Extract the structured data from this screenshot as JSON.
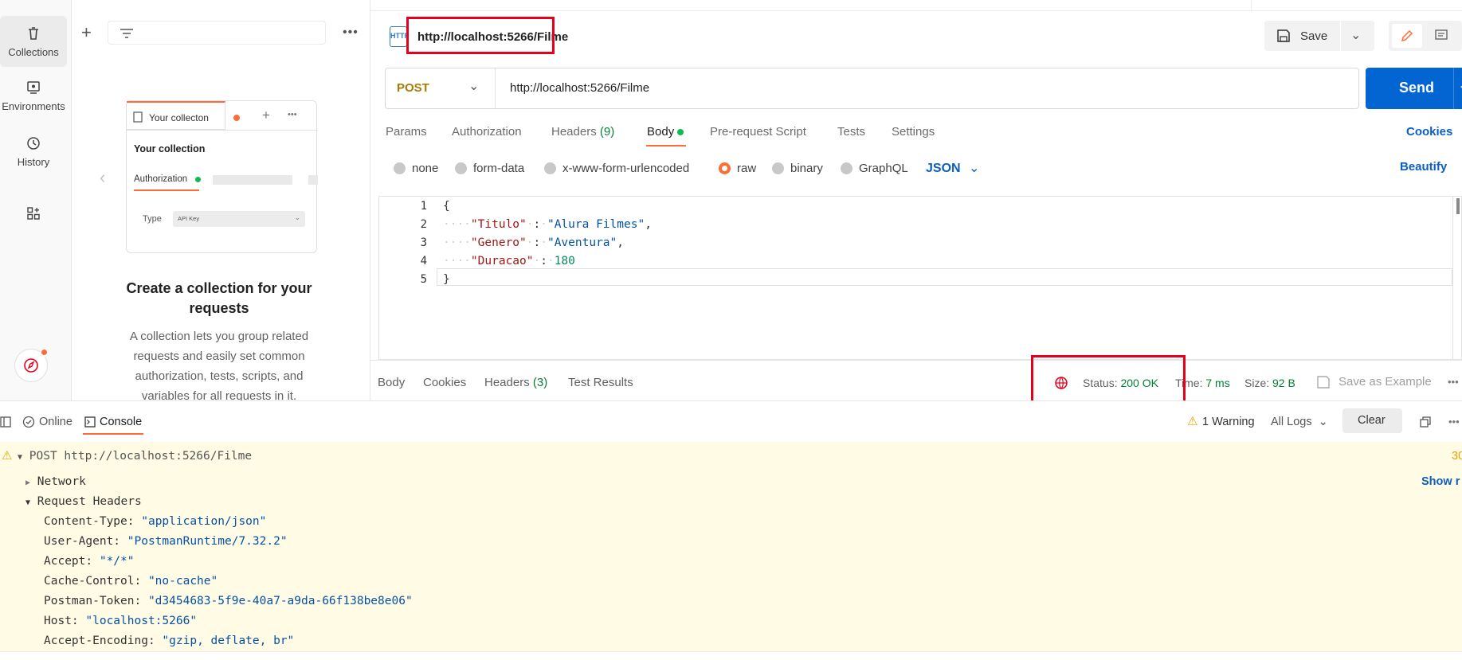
{
  "rail": {
    "collections": "Collections",
    "environments": "Environments",
    "history": "History"
  },
  "sidebar": {
    "preview_tab": "Your collecton",
    "preview_title": "Your collection",
    "preview_auth": "Authorization",
    "preview_type": "Type",
    "preview_type_value": "API Key",
    "empty_title": "Create a collection for your requests",
    "empty_desc": "A collection lets you group related requests and easily set common authorization, tests, scripts, and variables for all requests in it."
  },
  "request": {
    "badge": "HTTP",
    "name": "http://localhost:5266/Filme",
    "save": "Save",
    "method": "POST",
    "url": "http://localhost:5266/Filme",
    "send": "Send"
  },
  "tabs": {
    "params": "Params",
    "authorization": "Authorization",
    "headers": "Headers",
    "headers_count": "(9)",
    "body": "Body",
    "prerequest": "Pre-request Script",
    "tests": "Tests",
    "settings": "Settings",
    "cookies": "Cookies"
  },
  "body_types": {
    "none": "none",
    "form_data": "form-data",
    "urlencoded": "x-www-form-urlencoded",
    "raw": "raw",
    "binary": "binary",
    "graphql": "GraphQL",
    "format": "JSON",
    "beautify": "Beautify"
  },
  "code": {
    "line_numbers": [
      "1",
      "2",
      "3",
      "4",
      "5"
    ],
    "open": "{",
    "close": "}",
    "k1": "\"Titulo\"",
    "v1": "\"Alura Filmes\"",
    "k2": "\"Genero\"",
    "v2": "\"Aventura\"",
    "k3": "\"Duracao\"",
    "v3": "180"
  },
  "response": {
    "body": "Body",
    "cookies": "Cookies",
    "headers": "Headers",
    "headers_count": "(3)",
    "test_results": "Test Results",
    "status_label": "Status:",
    "status_value": "200 OK",
    "time_label": "Time:",
    "time_value": "7 ms",
    "size_label": "Size:",
    "size_value": "92 B",
    "save_example": "Save as Example"
  },
  "console": {
    "online": "Online",
    "console": "Console",
    "warning": "1 Warning",
    "all_logs": "All Logs",
    "clear": "Clear",
    "entry": "POST http://localhost:5266/Filme",
    "entry_right": "30",
    "network": "Network",
    "show": "Show r",
    "request_headers": "Request Headers",
    "headers": [
      {
        "k": "Content-Type:",
        "v": "\"application/json\""
      },
      {
        "k": "User-Agent:",
        "v": "\"PostmanRuntime/7.32.2\""
      },
      {
        "k": "Accept:",
        "v": "\"*/*\""
      },
      {
        "k": "Cache-Control:",
        "v": "\"no-cache\""
      },
      {
        "k": "Postman-Token:",
        "v": "\"d3454683-5f9e-40a7-a9da-66f138be8e06\""
      },
      {
        "k": "Host:",
        "v": "\"localhost:5266\""
      },
      {
        "k": "Accept-Encoding:",
        "v": "\"gzip, deflate, br\""
      }
    ]
  },
  "colors": {
    "accent": "#ff6c37",
    "send": "#0265d2",
    "link": "#0b5fc2",
    "status_ok": "#007f31",
    "highlight": "#e5001b",
    "console_bg": "#fffbe5"
  }
}
